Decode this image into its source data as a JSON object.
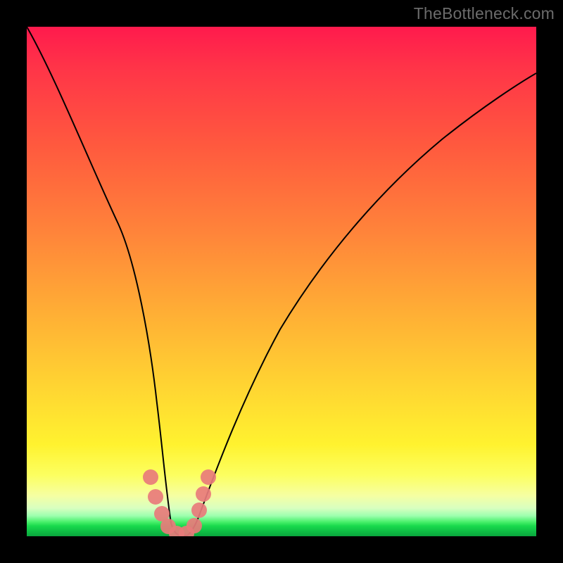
{
  "watermark": "TheBottleneck.com",
  "chart_data": {
    "type": "line",
    "title": "",
    "xlabel": "",
    "ylabel": "",
    "xlim": [
      0,
      100
    ],
    "ylim": [
      0,
      100
    ],
    "grid": false,
    "series": [
      {
        "name": "bottleneck-curve",
        "x": [
          0,
          5,
          10,
          15,
          20,
          23,
          25,
          27,
          28,
          29,
          30,
          31,
          32,
          33,
          35,
          40,
          45,
          50,
          55,
          60,
          65,
          70,
          75,
          80,
          85,
          90,
          95,
          100
        ],
        "y": [
          100,
          82,
          64,
          46,
          28,
          15,
          8,
          3,
          1,
          0,
          0,
          0,
          2,
          4,
          10,
          25,
          37,
          47,
          55,
          62,
          68,
          73,
          77,
          81,
          84,
          87,
          89,
          91
        ]
      }
    ],
    "markers": [
      {
        "x": 23.5,
        "y": 12
      },
      {
        "x": 24.5,
        "y": 8
      },
      {
        "x": 25.5,
        "y": 5
      },
      {
        "x": 26.5,
        "y": 2
      },
      {
        "x": 28.0,
        "y": 0.5
      },
      {
        "x": 30.0,
        "y": 0.5
      },
      {
        "x": 31.5,
        "y": 2
      },
      {
        "x": 32.5,
        "y": 5
      },
      {
        "x": 33.5,
        "y": 8
      },
      {
        "x": 34.5,
        "y": 12
      }
    ],
    "gradient_stops": [
      {
        "pct": 0,
        "color": "#ff1a4d"
      },
      {
        "pct": 50,
        "color": "#ffb233"
      },
      {
        "pct": 85,
        "color": "#ffff30"
      },
      {
        "pct": 95,
        "color": "#c8ffb0"
      },
      {
        "pct": 100,
        "color": "#0aa63e"
      }
    ]
  }
}
